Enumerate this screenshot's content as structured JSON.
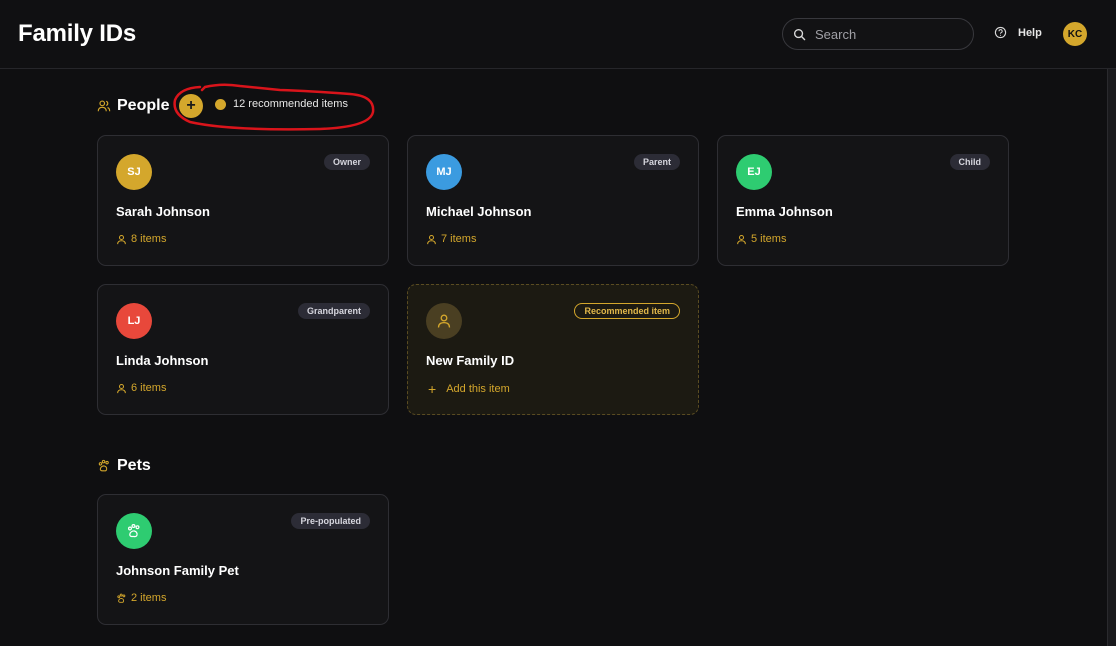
{
  "header": {
    "title": "Family IDs",
    "search_placeholder": "Search",
    "help_label": "Help",
    "user_initials": "KC"
  },
  "people": {
    "heading": "People",
    "add_label": "+",
    "recommended_text": "12 recommended items",
    "cards": [
      {
        "initials": "SJ",
        "name": "Sarah Johnson",
        "role": "Owner",
        "items": "8 items",
        "color": "#d4a72c"
      },
      {
        "initials": "MJ",
        "name": "Michael Johnson",
        "role": "Parent",
        "items": "7 items",
        "color": "#3b9be0"
      },
      {
        "initials": "EJ",
        "name": "Emma Johnson",
        "role": "Child",
        "items": "5 items",
        "color": "#2ecc71"
      },
      {
        "initials": "LJ",
        "name": "Linda Johnson",
        "role": "Grandparent",
        "items": "6 items",
        "color": "#e8483b"
      }
    ],
    "recommended_card": {
      "name": "New Family ID",
      "badge": "Recommended item",
      "action": "Add this item"
    }
  },
  "pets": {
    "heading": "Pets",
    "cards": [
      {
        "name": "Johnson Family Pet",
        "badge": "Pre-populated",
        "items": "2 items",
        "color": "#2ecc71"
      }
    ]
  },
  "colors": {
    "accent": "#d4a72c",
    "background": "#0f0f11",
    "annotation": "#d9141b"
  }
}
